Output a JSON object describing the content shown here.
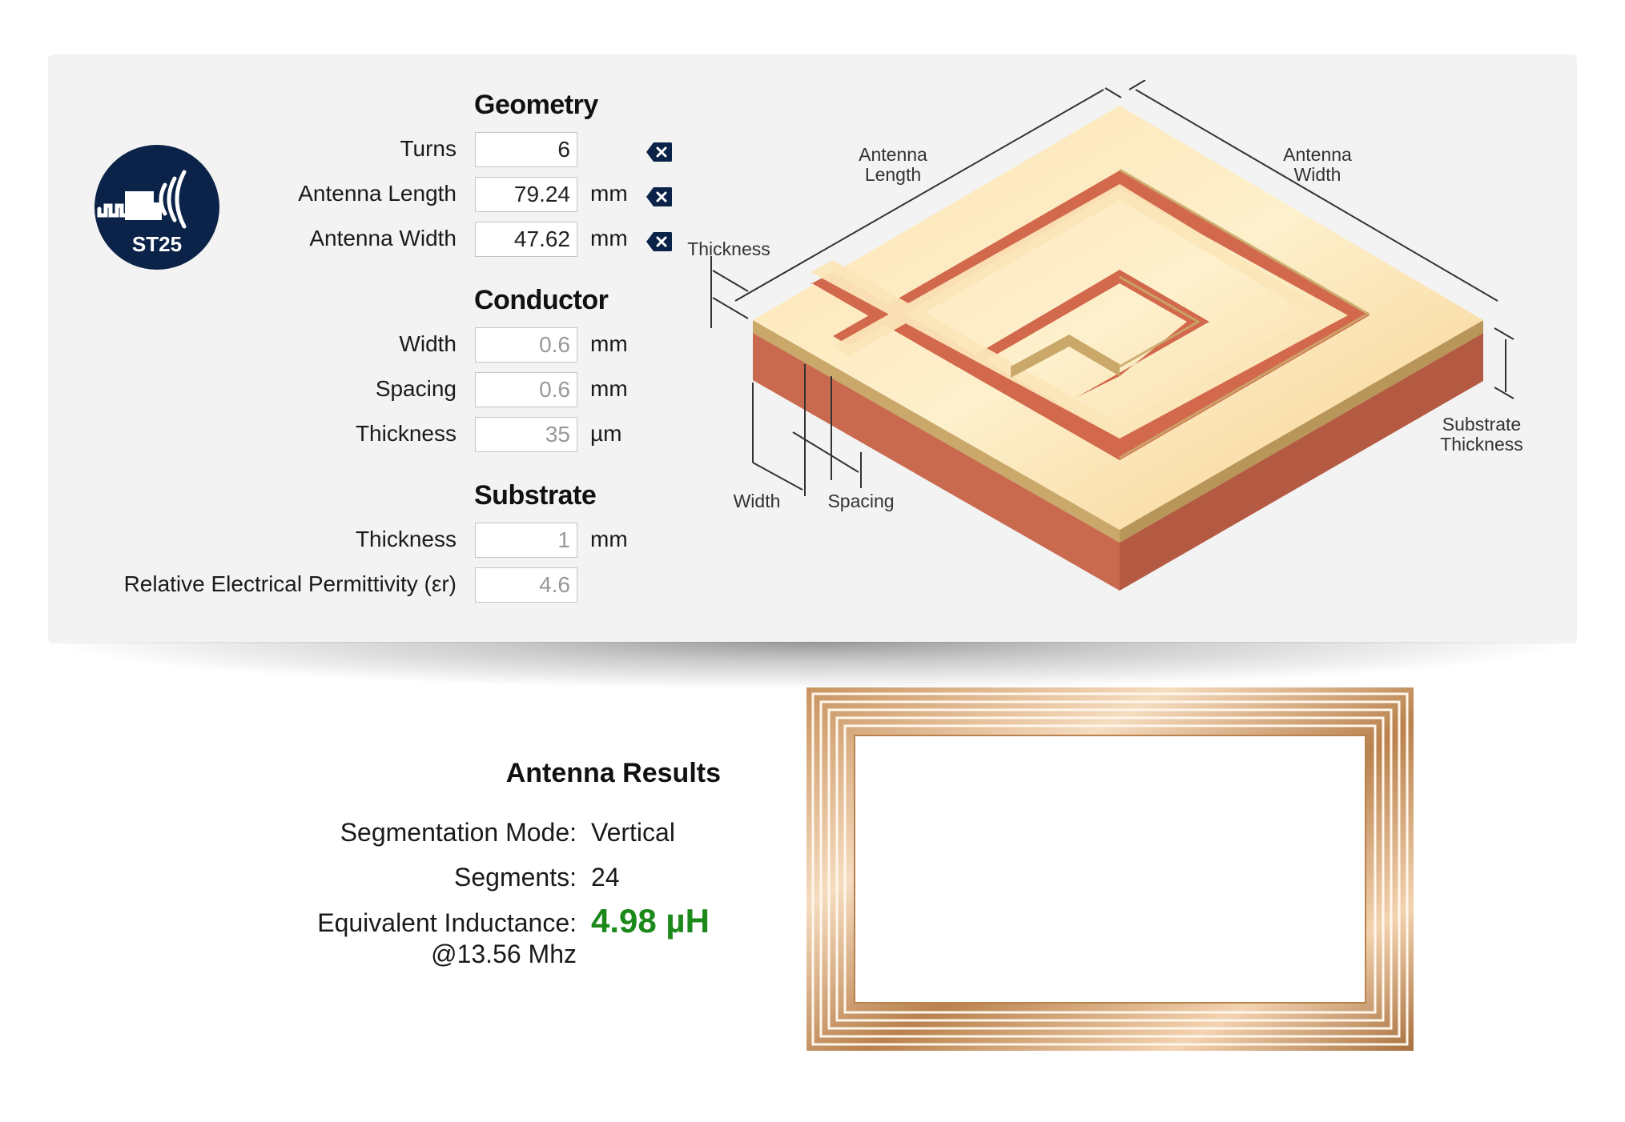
{
  "logo": {
    "text": "ST25",
    "icon": "nfc-antenna-icon",
    "bg_color": "#0b2348"
  },
  "geometry": {
    "title": "Geometry",
    "turns": {
      "label": "Turns",
      "value": "6"
    },
    "antenna_length": {
      "label": "Antenna Length",
      "value": "79.24",
      "unit": "mm"
    },
    "antenna_width": {
      "label": "Antenna Width",
      "value": "47.62",
      "unit": "mm"
    },
    "clear_icon": "backspace-clear-icon"
  },
  "conductor": {
    "title": "Conductor",
    "width": {
      "label": "Width",
      "value": "0.6",
      "unit": "mm"
    },
    "spacing": {
      "label": "Spacing",
      "value": "0.6",
      "unit": "mm"
    },
    "thickness": {
      "label": "Thickness",
      "value": "35",
      "unit": "µm"
    }
  },
  "substrate": {
    "title": "Substrate",
    "thickness": {
      "label": "Thickness",
      "value": "1",
      "unit": "mm"
    },
    "permittivity": {
      "label": "Relative Electrical Permittivity (εr)",
      "value": "4.6"
    }
  },
  "diagram": {
    "antenna_length_l1": "Antenna",
    "antenna_length_l2": "Length",
    "antenna_width_l1": "Antenna",
    "antenna_width_l2": "Width",
    "thickness": "Thickness",
    "width": "Width",
    "spacing": "Spacing",
    "substrate_thickness_l1": "Substrate",
    "substrate_thickness_l2": "Thickness",
    "colors": {
      "conductor": "#f7d9a0",
      "substrate": "#c96a4e",
      "edge": "#c9a86a"
    }
  },
  "results": {
    "title": "Antenna Results",
    "segmentation_mode": {
      "label": "Segmentation Mode:",
      "value": "Vertical"
    },
    "segments": {
      "label": "Segments:",
      "value": "24"
    },
    "inductance": {
      "label": "Equivalent Inductance:",
      "sub_label": "@13.56 Mhz",
      "value": "4.98 µH",
      "color": "#1b8a1b"
    }
  }
}
